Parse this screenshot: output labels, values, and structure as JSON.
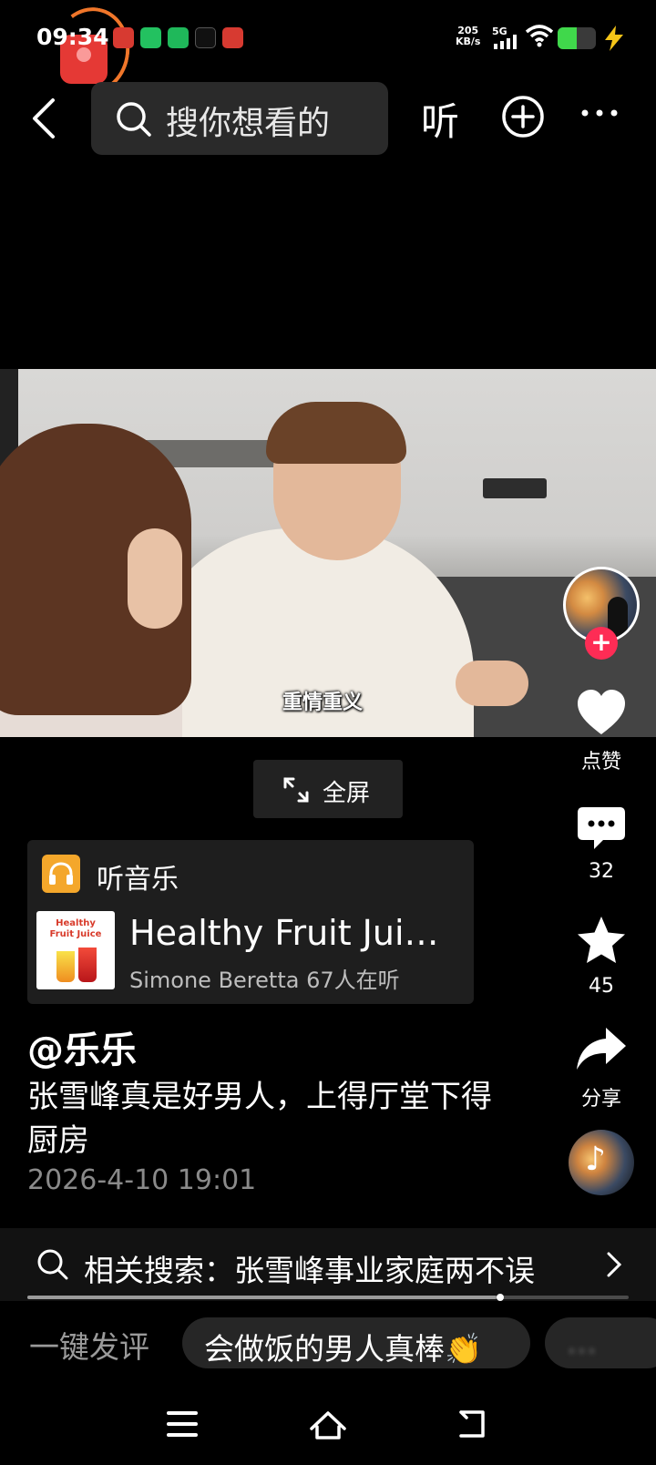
{
  "status_bar": {
    "time": "09:34",
    "net_speed_value": "205",
    "net_speed_unit": "KB/s",
    "network_type": "5G",
    "battery_level": 0.5,
    "app_notification_icons": [
      "toutiao-icon",
      "wechat-icon",
      "wechat-moments-icon",
      "douyin-icon",
      "toutiao-icon"
    ]
  },
  "top_bar": {
    "search_placeholder": "搜你想看的",
    "listen_label": "听"
  },
  "video": {
    "subtitle": "重情重义"
  },
  "fullscreen": {
    "label": "全屏"
  },
  "right_rail": {
    "like_label": "点赞",
    "comment_count": "32",
    "favorite_count": "45",
    "share_label": "分享"
  },
  "music_card": {
    "header": "听音乐",
    "cover_text_line1": "Healthy",
    "cover_text_line2": "Fruit Juice",
    "song_title": "Healthy Fruit Jui…",
    "meta": "Simone Beretta 67人在听"
  },
  "post": {
    "author": "@乐乐",
    "description": "张雪峰真是好男人，上得厅堂下得厨房",
    "datetime": "2026-4-10 19:01"
  },
  "related_search": {
    "text": "相关搜索：张雪峰事业家庭两不误",
    "progress": 0.78
  },
  "quick_comment": {
    "label": "一键发评",
    "chips": [
      "会做饭的男人真棒👏",
      "…"
    ]
  },
  "colors": {
    "background": "#000000",
    "accent_red": "#fe2c55",
    "music_icon_orange": "#f4a72b",
    "battery_green": "#40d84b"
  }
}
